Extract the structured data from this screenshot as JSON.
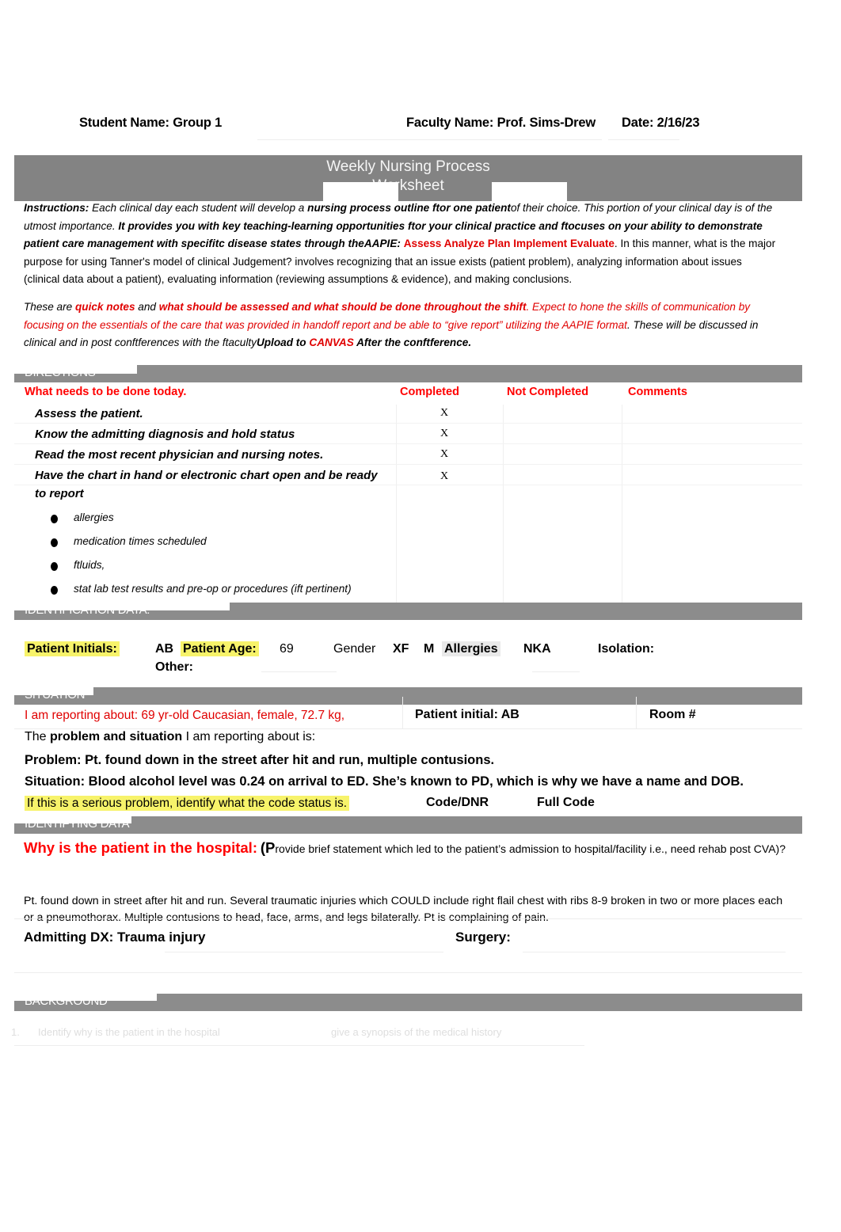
{
  "header": {
    "student_name": "Student Name: Group 1",
    "faculty_name": "Faculty Name: Prof. Sims-Drew",
    "date": "Date: 2/16/23"
  },
  "title": {
    "line1": "Weekly Nursing Process",
    "line2": "Worksheet"
  },
  "instructions": {
    "label": "Instructions:",
    "s1": " Each clinical day each student will develop a ",
    "s2": "nursing process outline ftor one patient",
    "s3": "of their choice. This portion of your clinical day is of the utmost importance. ",
    "s4": "It provides you with key teaching-learning opportunities ftor your clinical practice and ftocuses on your ability to demonstrate patient care management with specifitc disease states through the",
    "s5": "AAPIE: ",
    "s6": "Assess Analyze Plan Implement Evaluate",
    "s7": ". In this manner, what is the major purpose for using Tanner's model of clinical Judgement? involves recognizing that an issue exists (patient problem), analyzing information about issues (clinical data about a patient), evaluating information (reviewing assumptions & evidence), and making conclusions."
  },
  "paragraph2": {
    "p1": "These are ",
    "p2": "quick notes",
    "p3": " and ",
    "p4": "what should be assessed and what should be done throughout the shift",
    "p5": ". Expect to hone the skills of communication by focusing on the essentials of the care that was provided in handoff report and be able to “give report” utilizing the AAPIE format",
    "p6": ". These will be discussed in clinical and in post conftferences with the ftaculty",
    "p7": "Upload to ",
    "p8": "CANVAS",
    "p9": " After the conftference."
  },
  "sections": {
    "directions": "DIRECTIONS",
    "identification_data": "IDENTIFICATION DATA:",
    "situation": "SITUATION",
    "identifying_data": "IDENTIFYING DATA",
    "background": "BACKGROUND"
  },
  "directions_table": {
    "columns": [
      "What needs to be done today.",
      "Completed",
      "Not Completed",
      "Comments"
    ],
    "rows": [
      {
        "task": "Assess the patient.",
        "completed": "X",
        "not_completed": "",
        "comments": ""
      },
      {
        "task": "Know the admitting diagnosis and hold status",
        "completed": "X",
        "not_completed": "",
        "comments": ""
      },
      {
        "task": "Read the most recent physician and nursing notes.",
        "completed": "X",
        "not_completed": "",
        "comments": ""
      },
      {
        "task": "Have the chart in hand or electronic chart open and be ready to report",
        "completed": "X",
        "not_completed": "",
        "comments": ""
      }
    ],
    "bullets": [
      "allergies",
      "medication times scheduled",
      "ftluids,",
      "stat lab test results and pre-op or procedures (ift pertinent)"
    ]
  },
  "identification": {
    "initials_label": "Patient Initials:",
    "initials_value": "AB",
    "age_label": "Patient Age:",
    "age_value": "69",
    "gender_label": "Gender",
    "gender_value": "XF",
    "gender_value2": "M",
    "allergies_label": "Allergies",
    "allergies_value": "NKA",
    "isolation_label": "Isolation:",
    "other_label": "Other:"
  },
  "situation": {
    "reporting_about": "I am reporting about: 69 yr-old Caucasian, female, 72.7 kg,",
    "patient_initial": "Patient initial: AB",
    "room": "Room #",
    "problem_lead_1": "The ",
    "problem_lead_2": "problem and situation",
    "problem_lead_3": " I am reporting about is:",
    "problem": "Problem: Pt. found down in the street after hit and run, multiple contusions.",
    "situation_text": "Situation: Blood alcohol level was 0.24 on arrival to ED. She’s known to PD, which is why we have a name and DOB.",
    "code_prompt": "If this is a serious problem, identify what the code status is.",
    "code_label": "Code/DNR",
    "code_value": "Full Code"
  },
  "identifying": {
    "question_bold": "Why is the patient in the hospital:",
    "question_paren_cap": "(P",
    "question_rest": "rovide brief statement which led to the patient’s admission to hospital/facility i.e., need rehab post CVA)?",
    "narrative": "Pt. found down in street after hit and run. Several traumatic injuries which COULD include right flail chest with ribs 8-9 broken in two or more places each or a pneumothorax. Multiple contusions to head, face, arms, and legs bilaterally. Pt is complaining of pain.",
    "admitting_dx": "Admitting DX: Trauma injury",
    "surgery_label": "Surgery:"
  },
  "background": {
    "item_number": "1.",
    "faded_text_1": "Identify why is the patient in the hospital",
    "faded_text_2": "give a synopsis of the medical history"
  },
  "colors": {
    "gray_bar": "#8c8c8c",
    "title_bar": "#838383",
    "red": "#ff0000",
    "highlight": "#f7f36a"
  }
}
